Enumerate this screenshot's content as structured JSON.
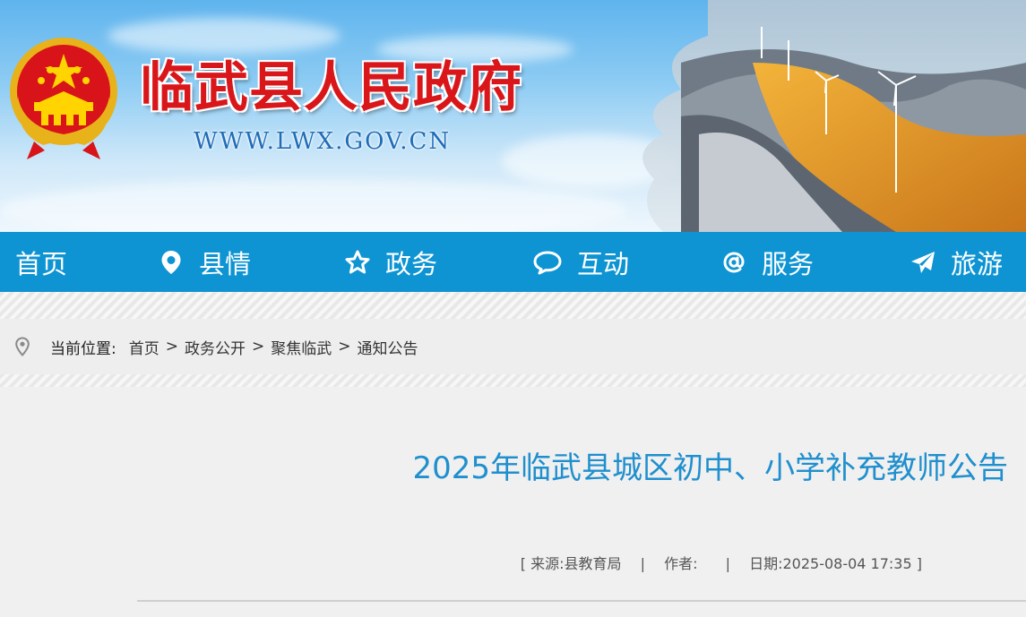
{
  "header": {
    "site_title": "临武县人民政府",
    "site_url": "WWW.LWX.GOV.CN",
    "emblem_icon": "national-emblem-icon",
    "colors": {
      "title": "#d9161a",
      "url": "#1f6cb7",
      "sky": "#5fb4ee"
    }
  },
  "nav": {
    "background": "#0e94d3",
    "items": [
      {
        "label": "首页",
        "icon": ""
      },
      {
        "label": "县情",
        "icon": "location-pin-icon"
      },
      {
        "label": "政务",
        "icon": "star-icon"
      },
      {
        "label": "互动",
        "icon": "chat-bubble-icon"
      },
      {
        "label": "服务",
        "icon": "at-sign-icon"
      },
      {
        "label": "旅游",
        "icon": "paper-plane-icon"
      }
    ]
  },
  "breadcrumb": {
    "icon": "location-icon",
    "label": "当前位置:",
    "items": [
      "首页",
      "政务公开",
      "聚焦临武",
      "通知公告"
    ],
    "separator": ">"
  },
  "article": {
    "title": "2025年临武县城区初中、小学补充教师公告",
    "meta": {
      "open": "[",
      "source": "来源:县教育局",
      "author": "作者:",
      "date": "日期:2025-08-04 17:35",
      "close": "]",
      "pipe": "|"
    },
    "title_color": "#1f8fce"
  }
}
